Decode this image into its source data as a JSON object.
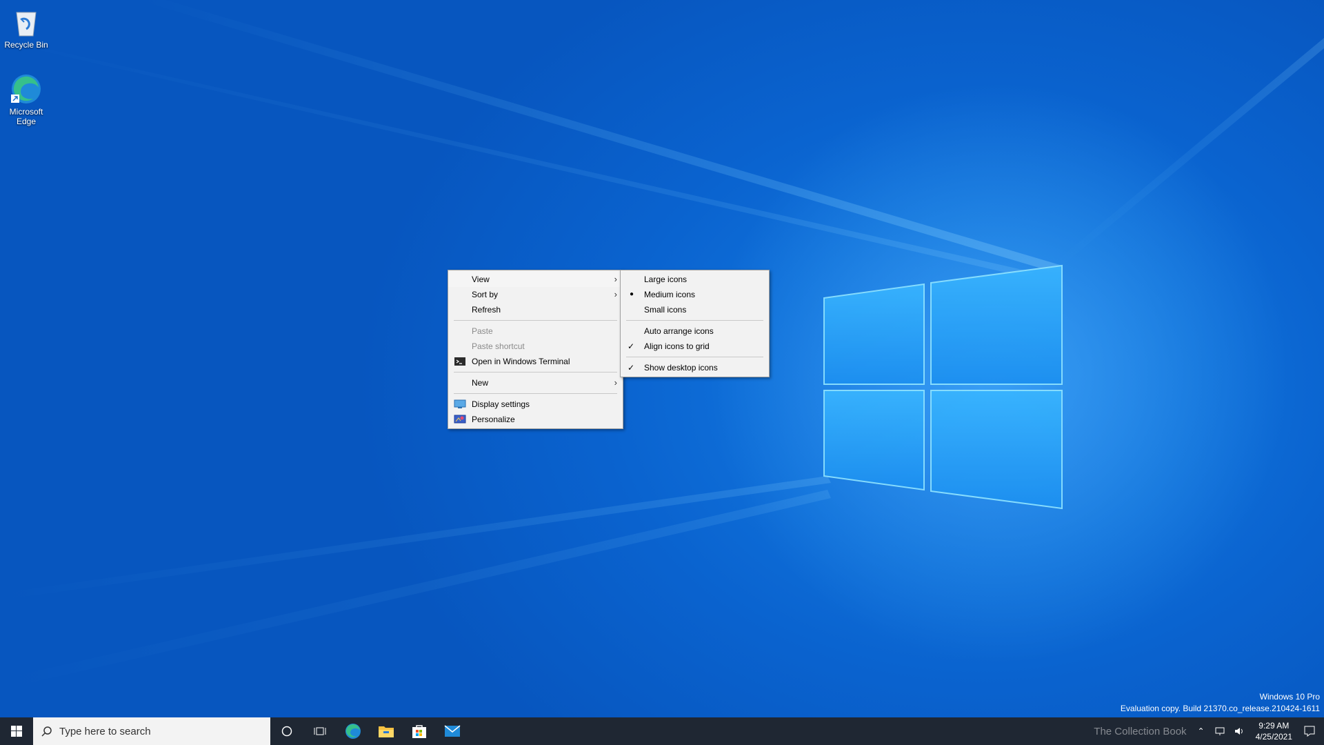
{
  "desktop": {
    "icons": [
      {
        "label": "Recycle Bin"
      },
      {
        "label": "Microsoft Edge"
      }
    ]
  },
  "context_menu": {
    "items": [
      {
        "label": "View",
        "submenu": true,
        "highlighted": true
      },
      {
        "label": "Sort by",
        "submenu": true
      },
      {
        "label": "Refresh"
      },
      {
        "label": "Paste",
        "disabled": true
      },
      {
        "label": "Paste shortcut",
        "disabled": true
      },
      {
        "label": "Open in Windows Terminal",
        "icon": "terminal-icon"
      },
      {
        "label": "New",
        "submenu": true
      },
      {
        "label": "Display settings",
        "icon": "display-icon"
      },
      {
        "label": "Personalize",
        "icon": "personalize-icon"
      }
    ]
  },
  "view_submenu": {
    "items": [
      {
        "label": "Large icons"
      },
      {
        "label": "Medium icons",
        "bullet": true
      },
      {
        "label": "Small icons"
      },
      {
        "label": "Auto arrange icons"
      },
      {
        "label": "Align icons to grid",
        "checked": true
      },
      {
        "label": "Show desktop icons",
        "checked": true
      }
    ]
  },
  "taskbar": {
    "search_placeholder": "Type here to search",
    "pinned": [
      "start-icon",
      "cortana-icon",
      "task-view-icon",
      "edge-icon",
      "file-explorer-icon",
      "store-icon",
      "mail-icon"
    ],
    "time": "9:29 AM",
    "date": "4/25/2021",
    "overlay_text": "The Collection Book"
  },
  "watermark": {
    "line1": "Windows 10 Pro",
    "line2": "Evaluation copy. Build 21370.co_release.210424-1611"
  },
  "colors": {
    "accent": "#0a63cf",
    "taskbar": "#1f2733",
    "menu_bg": "#f2f2f2"
  }
}
